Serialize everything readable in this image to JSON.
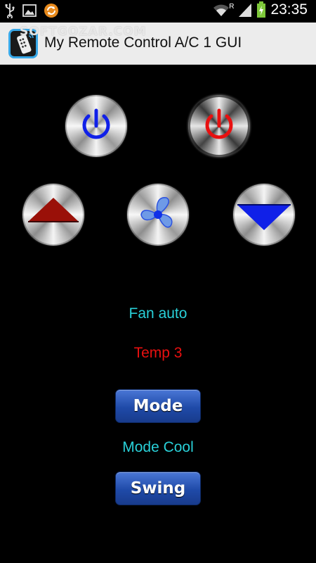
{
  "status_bar": {
    "time": "23:35",
    "roaming_indicator": "R",
    "icons": [
      "usb-icon",
      "gallery-icon",
      "sync-icon",
      "wifi-icon",
      "signal-icon",
      "battery-charging-icon"
    ]
  },
  "app": {
    "title": "My Remote Control A/C 1 GUI",
    "icon": "remote-control-icon",
    "watermark": "SOFTGOZAR.COM"
  },
  "buttons": {
    "power_on": {
      "icon": "power-icon",
      "color": "#1020e8"
    },
    "power_off": {
      "icon": "power-icon",
      "color": "#e81010"
    },
    "temp_up": {
      "icon": "triangle-up-icon",
      "color": "#9a1008"
    },
    "fan": {
      "icon": "fan-icon",
      "color": "#2a50e0"
    },
    "temp_down": {
      "icon": "triangle-down-icon",
      "color": "#1020e8"
    },
    "mode_label": "Mode",
    "swing_label": "Swing"
  },
  "status": {
    "fan": "Fan auto",
    "fan_color": "#29d0d8",
    "temp": "Temp 3",
    "temp_color": "#e81010",
    "mode": "Mode Cool",
    "mode_color": "#29d0d8"
  }
}
